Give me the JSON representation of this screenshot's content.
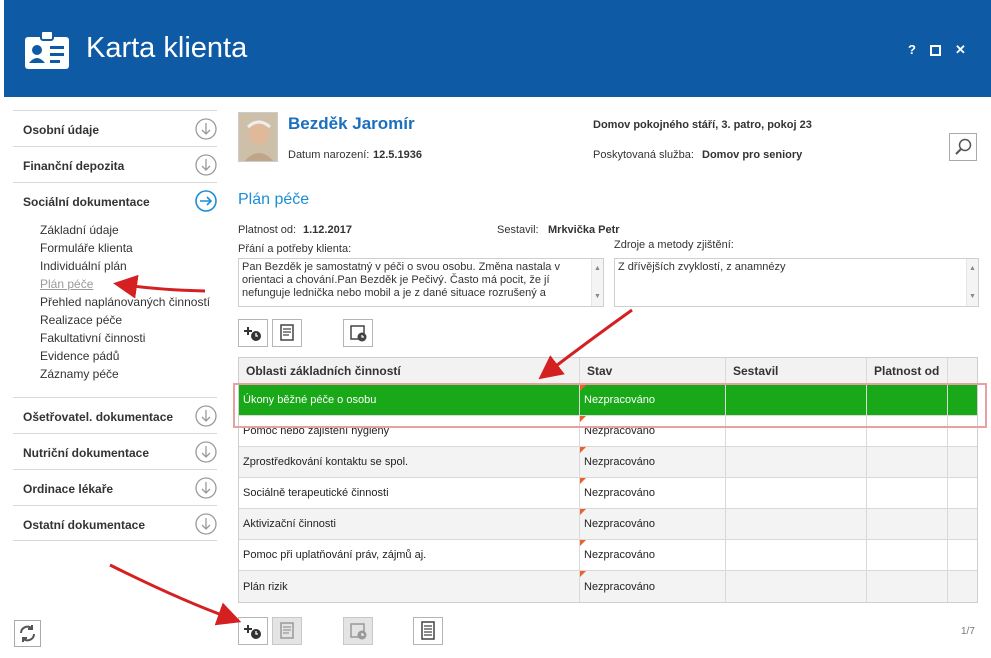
{
  "window": {
    "title": "Karta klienta",
    "help_label": "?",
    "close_label": "✕"
  },
  "sidebar": {
    "sections": [
      {
        "label": "Osobní údaje"
      },
      {
        "label": "Finanční depozita"
      },
      {
        "label": "Sociální dokumentace"
      },
      {
        "label": "Ošetřovatel. dokumentace"
      },
      {
        "label": "Nutriční dokumentace"
      },
      {
        "label": "Ordinace lékaře"
      },
      {
        "label": "Ostatní dokumentace"
      }
    ],
    "social_items": [
      {
        "label": "Základní údaje"
      },
      {
        "label": "Formuláře klienta"
      },
      {
        "label": "Individuální plán"
      },
      {
        "label": "Plán péče"
      },
      {
        "label": "Přehled naplánovaných činností"
      },
      {
        "label": "Realizace péče"
      },
      {
        "label": "Fakultativní činnosti"
      },
      {
        "label": "Evidence pádů"
      },
      {
        "label": "Záznamy péče"
      }
    ]
  },
  "client": {
    "name": "Bezděk Jaromír",
    "birth_label": "Datum narození:",
    "birth_value": "12.5.1936",
    "location": "Domov pokojného stáří, 3. patro, pokoj 23",
    "service_label": "Poskytovaná služba:",
    "service_value": "Domov pro seniory"
  },
  "plan": {
    "title": "Plán péče",
    "valid_label": "Platnost od:",
    "valid_value": "1.12.2017",
    "author_label": "Sestavil:",
    "author_value": "Mrkvička Petr",
    "wishes_label": "Přání a potřeby klienta:",
    "wishes_text": "Pan Bezděk je samostatný v péči o svou osobu. Změna nastala v orientaci a chování.Pan Bezděk je Pečivý. Často má pocit, že jí nefunguje lednička nebo mobil a je z dané situace rozrušený a",
    "sources_label": "Zdroje a metody zjištění:",
    "sources_text": "Z dřívějších zvyklostí, z anamnézy"
  },
  "table": {
    "columns": [
      "Oblasti základních činností",
      "Stav",
      "Sestavil",
      "Platnost od"
    ],
    "rows": [
      {
        "area": "Úkony běžné péče o osobu",
        "status": "Nezpracováno"
      },
      {
        "area": "Pomoc nebo zajištění hygieny",
        "status": "Nezpracováno"
      },
      {
        "area": "Zprostředkování kontaktu se spol.",
        "status": "Nezpracováno"
      },
      {
        "area": "Sociálně terapeutické činnosti",
        "status": "Nezpracováno"
      },
      {
        "area": "Aktivizační činnosti",
        "status": "Nezpracováno"
      },
      {
        "area": "Pomoc při uplatňování práv, zájmů aj.",
        "status": "Nezpracováno"
      },
      {
        "area": "Plán rizik",
        "status": "Nezpracováno"
      }
    ]
  },
  "pager": "1/7",
  "colors": {
    "titlebar": "#0f5aa4",
    "accent": "#1a8fd6",
    "selected_row": "#18a818",
    "annotation_arrow": "#d42020"
  }
}
